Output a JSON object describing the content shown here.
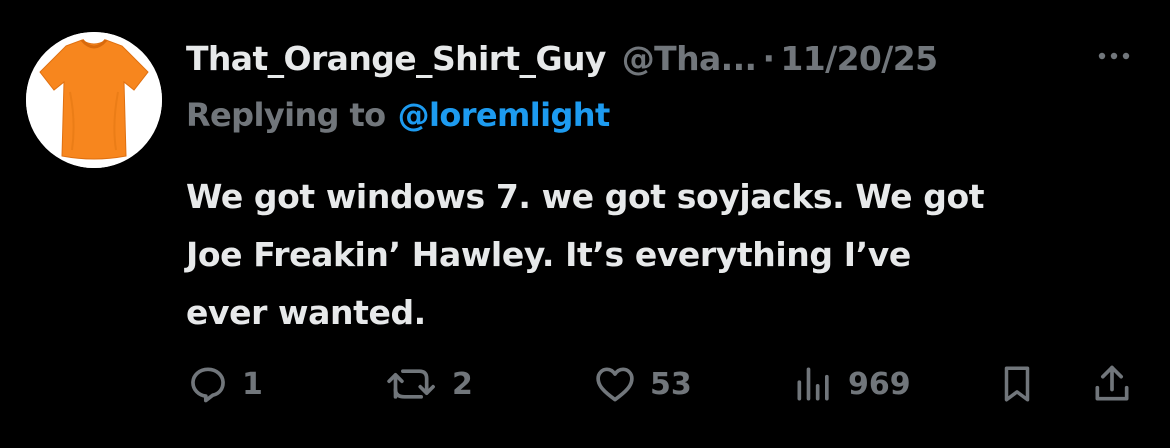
{
  "author": {
    "display_name": "That_Orange_Shirt_Guy",
    "handle": "@Tha...",
    "separator": "·",
    "timestamp": "11/20/25",
    "avatar_icon": "orange-t-shirt-icon",
    "avatar_color": "#f7861e"
  },
  "reply": {
    "prefix": "Replying to",
    "mention": "@loremlight"
  },
  "tweet": {
    "lines": [
      "We got windows 7. we got soyjacks. We got",
      "Joe Freakin’ Hawley. It’s everything I’ve",
      "ever wanted."
    ]
  },
  "actions": {
    "reply_count": "1",
    "retweet_count": "2",
    "like_count": "53",
    "views_count": "969"
  },
  "colors": {
    "background": "#000000",
    "primary_text": "#e7e9ea",
    "secondary_text": "#71767b",
    "link": "#1d9bf0"
  }
}
